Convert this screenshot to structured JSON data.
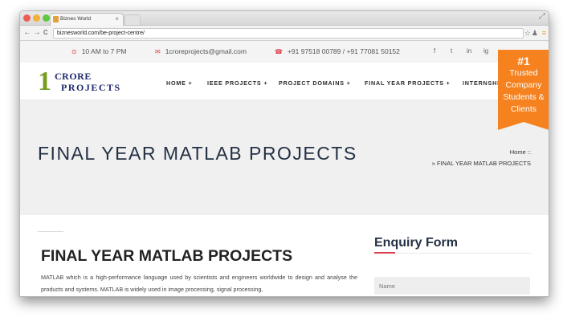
{
  "browser": {
    "tab_title": "Biznes World",
    "tab_close": "×",
    "url": "biznesworld.com/be-project-centre/",
    "back": "←",
    "forward": "→",
    "reload": "C",
    "resize": "⤢",
    "star": "☆",
    "menu": "≡",
    "traffic_lights": [
      "#ee5c54",
      "#f2b136",
      "#5fc740"
    ]
  },
  "topbar": {
    "hours": "10 AM to 7 PM",
    "email": "1croreprojects@gmail.com",
    "phone": "+91 97518 00789 / +91 77081 50152",
    "clock_icon": "⊙",
    "mail_icon": "✉",
    "phone_icon": "☎",
    "social": [
      "f",
      "t",
      "in",
      "ig"
    ],
    "social_icons": [
      "facebook-icon",
      "twitter-icon",
      "linkedin-icon",
      "instagram-icon"
    ]
  },
  "logo": {
    "digit": "1",
    "word1": "CRORE",
    "word2": "PROJECTS"
  },
  "nav": {
    "items": [
      "HOME +",
      "IEEE PROJECTS +",
      "PROJECT DOMAINS +",
      "FINAL YEAR PROJECTS +",
      "INTERNSHI"
    ]
  },
  "badge": {
    "number": "#1",
    "lines": [
      "Trusted",
      "Company",
      "Students &",
      "Clients"
    ]
  },
  "banner": {
    "title": "FINAL YEAR MATLAB PROJECTS",
    "crumb_home": "Home  ::",
    "crumb_current": "» FINAL YEAR MATLAB PROJECTS"
  },
  "content": {
    "heading": "FINAL YEAR MATLAB PROJECTS",
    "paragraph": "MATLAB which is a high-performance language used by scientists and engineers worldwide to design and analyse the products and systems. MATLAB is widely used in image processing, signal processing,"
  },
  "enquiry": {
    "title": "Enquiry Form",
    "name_placeholder": "Name"
  },
  "colors": {
    "accent": "#d9414e",
    "brand_navy": "#243044",
    "badge": "#f5821f",
    "logo_green": "#7a9c20"
  }
}
